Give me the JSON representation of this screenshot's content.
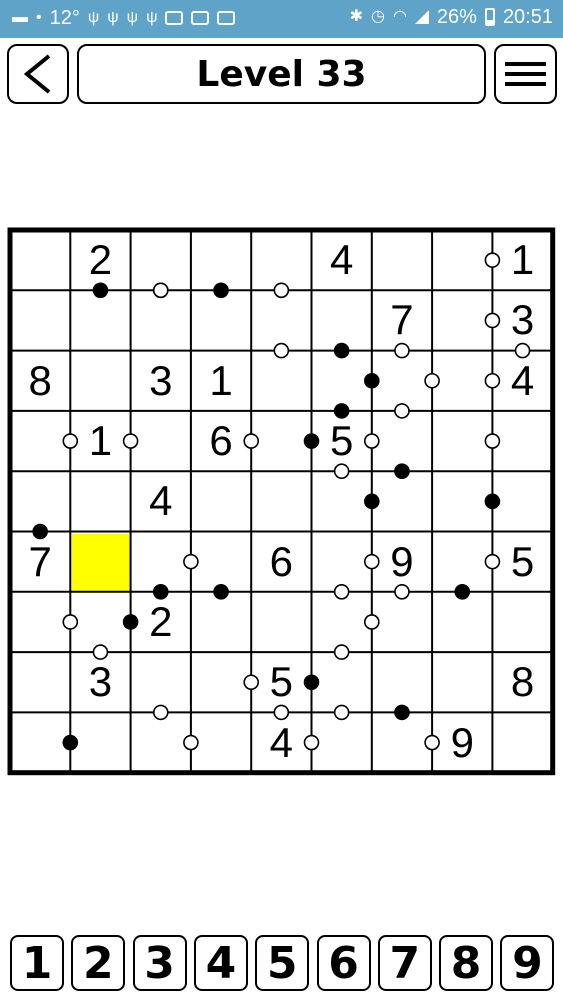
{
  "status_bar": {
    "temperature": "12°",
    "battery": "26%",
    "time": "20:51",
    "left_icons": [
      "chat-icon",
      "location-icon",
      "usb-icon",
      "usb-icon",
      "usb-icon",
      "usb-icon",
      "vr-icon",
      "image-icon",
      "clipboard-icon"
    ],
    "right_icons": [
      "bluetooth-icon",
      "alarm-icon",
      "wifi-icon",
      "signal-icon",
      "battery-icon"
    ]
  },
  "header": {
    "title": "Level 33",
    "back_icon": "chevron-left-icon",
    "menu_icon": "hamburger-menu-icon"
  },
  "board": {
    "size": 9,
    "selected_cell": {
      "row": 5,
      "col": 1
    },
    "selected_color": "#ffff00",
    "givens": [
      [
        null,
        2,
        null,
        null,
        null,
        4,
        null,
        null,
        1
      ],
      [
        null,
        null,
        null,
        null,
        null,
        null,
        7,
        null,
        3
      ],
      [
        8,
        null,
        3,
        1,
        null,
        null,
        null,
        null,
        4
      ],
      [
        null,
        1,
        null,
        6,
        null,
        5,
        null,
        null,
        null
      ],
      [
        null,
        null,
        4,
        null,
        null,
        null,
        null,
        null,
        null
      ],
      [
        7,
        null,
        null,
        null,
        6,
        null,
        9,
        null,
        5
      ],
      [
        null,
        null,
        2,
        null,
        null,
        null,
        null,
        null,
        null
      ],
      [
        null,
        3,
        null,
        null,
        5,
        null,
        null,
        null,
        8
      ],
      [
        null,
        null,
        null,
        null,
        4,
        null,
        null,
        9,
        null
      ]
    ],
    "vertical_dots": [
      {
        "row": 0,
        "col": 7,
        "type": "white"
      },
      {
        "row": 1,
        "col": 7,
        "type": "white"
      },
      {
        "row": 2,
        "col": 5,
        "type": "black"
      },
      {
        "row": 2,
        "col": 6,
        "type": "white"
      },
      {
        "row": 2,
        "col": 7,
        "type": "white"
      },
      {
        "row": 3,
        "col": 0,
        "type": "white"
      },
      {
        "row": 3,
        "col": 1,
        "type": "white"
      },
      {
        "row": 3,
        "col": 3,
        "type": "white"
      },
      {
        "row": 3,
        "col": 4,
        "type": "black"
      },
      {
        "row": 3,
        "col": 5,
        "type": "white"
      },
      {
        "row": 3,
        "col": 7,
        "type": "white"
      },
      {
        "row": 4,
        "col": 5,
        "type": "black"
      },
      {
        "row": 4,
        "col": 7,
        "type": "black"
      },
      {
        "row": 5,
        "col": 2,
        "type": "white"
      },
      {
        "row": 5,
        "col": 5,
        "type": "white"
      },
      {
        "row": 5,
        "col": 7,
        "type": "white"
      },
      {
        "row": 6,
        "col": 0,
        "type": "white"
      },
      {
        "row": 6,
        "col": 1,
        "type": "black"
      },
      {
        "row": 6,
        "col": 5,
        "type": "white"
      },
      {
        "row": 7,
        "col": 3,
        "type": "white"
      },
      {
        "row": 7,
        "col": 4,
        "type": "black"
      },
      {
        "row": 8,
        "col": 0,
        "type": "black"
      },
      {
        "row": 8,
        "col": 2,
        "type": "white"
      },
      {
        "row": 8,
        "col": 4,
        "type": "white"
      },
      {
        "row": 8,
        "col": 6,
        "type": "white"
      }
    ],
    "horizontal_dots": [
      {
        "row": 0,
        "col": 1,
        "type": "black"
      },
      {
        "row": 0,
        "col": 2,
        "type": "black"
      },
      {
        "row": 0,
        "col": 3,
        "type": "black"
      },
      {
        "row": 0,
        "col": 4,
        "type": "white"
      },
      {
        "row": 0,
        "col": 2,
        "type": "white",
        "offset": 0.5
      },
      {
        "row": 1,
        "col": 4,
        "type": "white"
      },
      {
        "row": 1,
        "col": 5,
        "type": "black"
      },
      {
        "row": 1,
        "col": 6,
        "type": "white"
      },
      {
        "row": 1,
        "col": 8,
        "type": "white"
      },
      {
        "row": 2,
        "col": 5,
        "type": "black"
      },
      {
        "row": 2,
        "col": 6,
        "type": "white"
      },
      {
        "row": 3,
        "col": 5,
        "type": "white"
      },
      {
        "row": 3,
        "col": 6,
        "type": "black"
      },
      {
        "row": 4,
        "col": 0,
        "type": "black"
      },
      {
        "row": 5,
        "col": 2,
        "type": "black"
      },
      {
        "row": 5,
        "col": 3,
        "type": "black"
      },
      {
        "row": 5,
        "col": 5,
        "type": "white"
      },
      {
        "row": 5,
        "col": 6,
        "type": "white"
      },
      {
        "row": 5,
        "col": 7,
        "type": "black"
      },
      {
        "row": 6,
        "col": 1,
        "type": "white"
      },
      {
        "row": 6,
        "col": 5,
        "type": "white"
      },
      {
        "row": 7,
        "col": 2,
        "type": "white"
      },
      {
        "row": 7,
        "col": 4,
        "type": "white"
      },
      {
        "row": 7,
        "col": 5,
        "type": "white"
      },
      {
        "row": 7,
        "col": 6,
        "type": "black"
      }
    ]
  },
  "keypad": [
    "1",
    "2",
    "3",
    "4",
    "5",
    "6",
    "7",
    "8",
    "9"
  ]
}
